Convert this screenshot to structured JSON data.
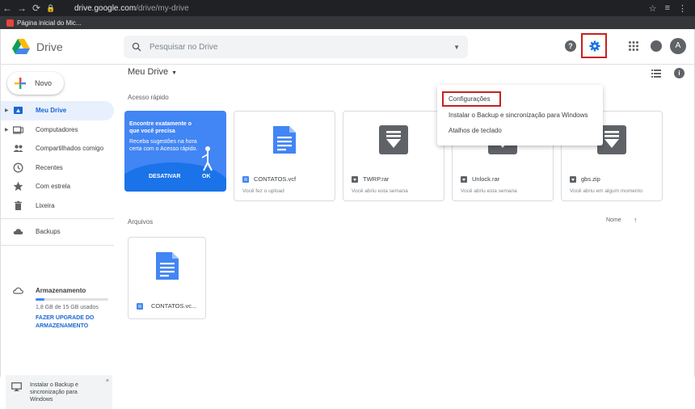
{
  "browser": {
    "url_host": "drive.google.com",
    "url_path": "/drive/my-drive",
    "bookmark": "Página inicial do Mic..."
  },
  "header": {
    "app_name": "Drive",
    "search_placeholder": "Pesquisar no Drive",
    "avatar_letter": "A",
    "help_glyph": "?",
    "icons": [
      "drive-logo-icon",
      "search-icon",
      "help-icon",
      "gear-icon",
      "apps-grid-icon",
      "notifications-icon",
      "avatar"
    ]
  },
  "sidebar": {
    "new_label": "Novo",
    "items": [
      {
        "label": "Meu Drive",
        "icon": "my-drive-icon",
        "active": true,
        "expandable": true
      },
      {
        "label": "Computadores",
        "icon": "computers-icon",
        "active": false,
        "expandable": true
      },
      {
        "label": "Compartilhados comigo",
        "icon": "shared-icon",
        "active": false,
        "expandable": false
      },
      {
        "label": "Recentes",
        "icon": "clock-icon",
        "active": false,
        "expandable": false
      },
      {
        "label": "Com estrela",
        "icon": "star-icon",
        "active": false,
        "expandable": false
      },
      {
        "label": "Lixeira",
        "icon": "trash-icon",
        "active": false,
        "expandable": false
      }
    ],
    "backups": {
      "label": "Backups",
      "icon": "cloud-icon"
    },
    "storage": {
      "label": "Armazenamento",
      "used_text": "1,8 GB de 15 GB usados",
      "used_fraction": 0.12,
      "upgrade_label": "FAZER UPGRADE DO ARMAZENAMENTO"
    },
    "backup_promo": {
      "text": "Instalar o Backup e sincronização para Windows",
      "close_glyph": "×"
    }
  },
  "main": {
    "title": "Meu Drive",
    "quick_access_label": "Acesso rápido",
    "promo": {
      "title": "Encontre exatamente o que você precisa",
      "body": "Receba sugestões na hora certa com o Acesso rápido.",
      "dismiss_label": "DESATIVAR",
      "ok_label": "OK"
    },
    "quick_files": [
      {
        "name": "CONTATOS.vcf",
        "meta": "Você fez o upload",
        "kind": "doc"
      },
      {
        "name": "TWRP.rar",
        "meta": "Você abriu esta semana",
        "kind": "archive"
      },
      {
        "name": "Unlock.rar",
        "meta": "Você abriu esta semana",
        "kind": "archive"
      },
      {
        "name": "gbs.zip",
        "meta": "Você abriu em algum momento",
        "kind": "archive"
      }
    ],
    "files_label": "Arquivos",
    "sort_label": "Nome",
    "sort_arrow": "↑",
    "files": [
      {
        "name": "CONTATOS.vc...",
        "kind": "doc"
      }
    ]
  },
  "settings_menu": {
    "items": [
      {
        "label": "Configurações",
        "highlighted": true
      },
      {
        "label": "Instalar o Backup e sincronização para Windows",
        "highlighted": false
      },
      {
        "label": "Atalhos de teclado",
        "highlighted": false
      }
    ]
  },
  "colors": {
    "accent": "#1a73e8",
    "highlight_border": "#c5221f",
    "active_nav_bg": "#e8f0fe",
    "archive_gray": "#5f6368",
    "doc_blue": "#4285f4"
  }
}
